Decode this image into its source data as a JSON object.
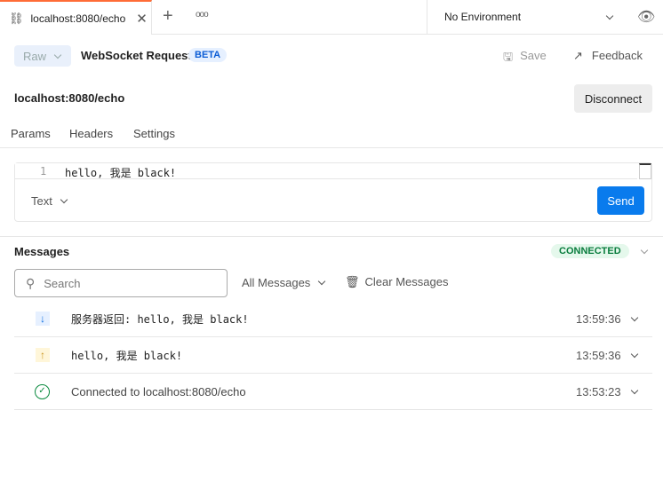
{
  "tab": {
    "title": "localhost:8080/echo"
  },
  "environment": {
    "selected": "No Environment"
  },
  "request": {
    "mode": "Raw",
    "type": "WebSocket Request",
    "badge": "BETA",
    "save": "Save",
    "feedback": "Feedback",
    "url": "localhost:8080/echo",
    "disconnect": "Disconnect"
  },
  "subtabs": [
    "Params",
    "Headers",
    "Settings"
  ],
  "editor": {
    "line": "1",
    "content": "hello, 我是 black!",
    "format": "Text",
    "send": "Send"
  },
  "messages": {
    "title": "Messages",
    "status": "CONNECTED",
    "search_placeholder": "Search",
    "filter": "All Messages",
    "clear": "Clear Messages",
    "items": [
      {
        "direction": "received",
        "text": "服务器返回: hello, 我是 black!",
        "time": "13:59:36"
      },
      {
        "direction": "sent",
        "text": "hello, 我是 black!",
        "time": "13:59:36"
      },
      {
        "direction": "connected",
        "text": "Connected to localhost:8080/echo",
        "time": "13:53:23"
      }
    ]
  },
  "colors": {
    "accent": "#ff6c37",
    "primary": "#097bed",
    "connected": "#0a7d3e"
  }
}
